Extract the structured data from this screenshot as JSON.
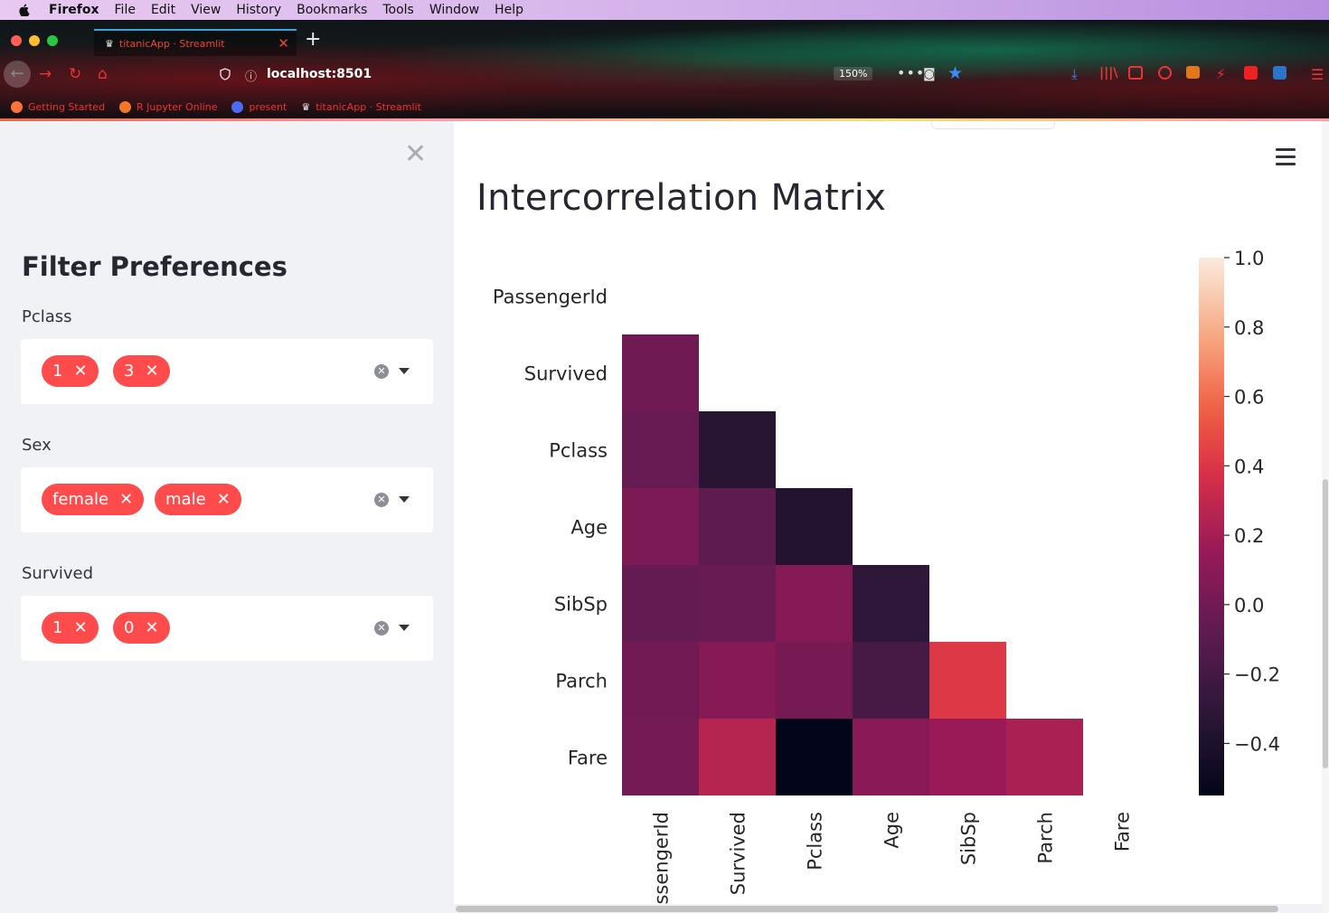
{
  "os_menubar": {
    "app": "Firefox",
    "items": [
      "File",
      "Edit",
      "View",
      "History",
      "Bookmarks",
      "Tools",
      "Window",
      "Help"
    ]
  },
  "browser": {
    "tab_title": "titanicApp · Streamlit",
    "url": "localhost:8501",
    "zoom": "150%",
    "bookmarks": [
      {
        "label": "Getting Started",
        "icon": "firefox-icon",
        "color": "#ff7139"
      },
      {
        "label": "R Jupyter Online",
        "icon": "jupyter-icon",
        "color": "#f37726"
      },
      {
        "label": "present",
        "icon": "c-icon",
        "color": "#4a6cf7"
      },
      {
        "label": "titanicApp · Streamlit",
        "icon": "crown-icon",
        "color": "#eeeeee"
      }
    ]
  },
  "sidebar": {
    "close_icon": "✕",
    "title": "Filter Preferences",
    "filters": [
      {
        "label": "Pclass",
        "chips": [
          "1",
          "3"
        ]
      },
      {
        "label": "Sex",
        "chips": [
          "female",
          "male"
        ]
      },
      {
        "label": "Survived",
        "chips": [
          "1",
          "0"
        ]
      }
    ],
    "chip_color": "#ff4b4b"
  },
  "main": {
    "title": "Intercorrelation Matrix"
  },
  "chart_data": {
    "type": "heatmap",
    "rows": [
      "PassengerId",
      "Survived",
      "Pclass",
      "Age",
      "SibSp",
      "Parch",
      "Fare"
    ],
    "cols": [
      "PassengerId",
      "Survived",
      "Pclass",
      "Age",
      "SibSp",
      "Parch",
      "Fare"
    ],
    "mask": "upper-triangle",
    "values": [
      [
        null,
        null,
        null,
        null,
        null,
        null,
        null
      ],
      [
        -0.01,
        null,
        null,
        null,
        null,
        null,
        null
      ],
      [
        -0.04,
        -0.34,
        null,
        null,
        null,
        null,
        null
      ],
      [
        0.04,
        -0.08,
        -0.37,
        null,
        null,
        null,
        null
      ],
      [
        -0.06,
        -0.04,
        0.08,
        -0.31,
        null,
        null,
        null
      ],
      [
        -0.0,
        0.08,
        0.02,
        -0.19,
        0.41,
        null,
        null
      ],
      [
        0.01,
        0.26,
        -0.55,
        0.1,
        0.16,
        0.22,
        null
      ]
    ],
    "colorbar": {
      "vmin": -0.55,
      "vmax": 1.0,
      "ticks": [
        "1.0",
        "0.8",
        "0.6",
        "0.4",
        "0.2",
        "0.0",
        "−0.2",
        "−0.4"
      ],
      "tick_values": [
        1.0,
        0.8,
        0.6,
        0.4,
        0.2,
        0.0,
        -0.2,
        -0.4
      ]
    },
    "colormap": "rocket"
  }
}
